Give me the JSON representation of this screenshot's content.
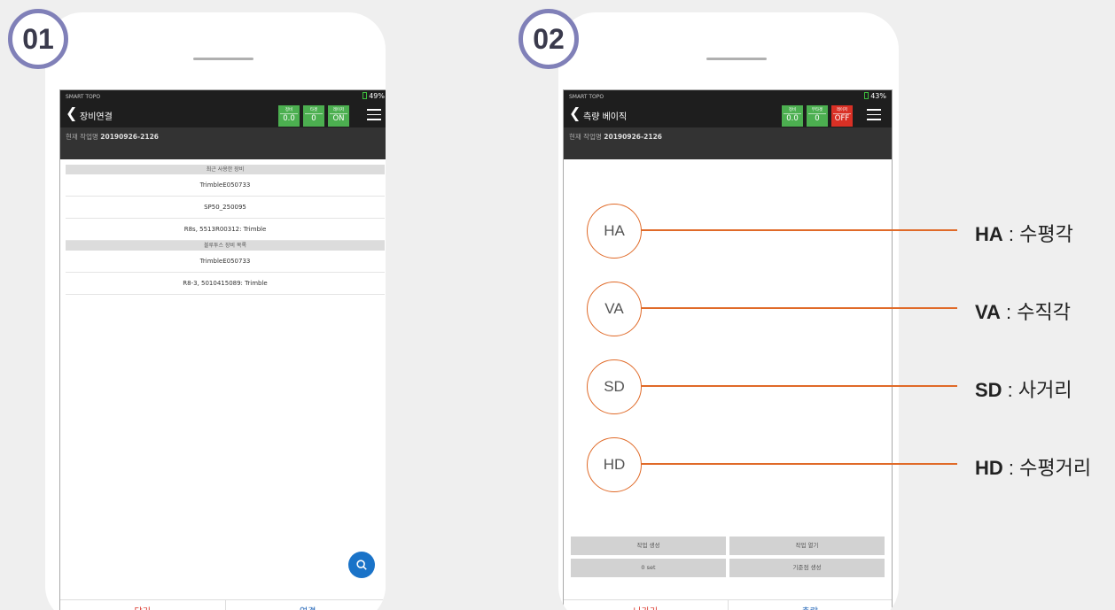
{
  "badges": {
    "first": "01",
    "second": "02"
  },
  "screen1": {
    "status_app": "SMART TOPO",
    "battery": "49%",
    "title": "장비연결",
    "indicators": [
      {
        "label": "정비",
        "value": "0.0",
        "color": "#4caf50"
      },
      {
        "label": "타겟",
        "value": "0",
        "color": "#4caf50"
      },
      {
        "label": "레이저",
        "value": "ON",
        "color": "#4caf50"
      }
    ],
    "job_prefix": "현재 작업명",
    "job_name": "20190926-2126",
    "recent_header": "최근 사용한 장비",
    "recent_devices": [
      "TrimbleE050733",
      "SP50_250095",
      "R8s, 5513R00312: Trimble"
    ],
    "bluetooth_header": "블루투스 장비 목록",
    "bluetooth_devices": [
      "TrimbleE050733",
      "R8-3, 5010415089: Trimble"
    ],
    "close_label": "닫기",
    "connect_label": "연결",
    "search_icon": "search-icon"
  },
  "screen2": {
    "status_app": "SMART TOPO",
    "battery": "43%",
    "title": "측량 베이직",
    "indicators": [
      {
        "label": "정비",
        "value": "0.0",
        "color": "#4caf50"
      },
      {
        "label": "무타겟",
        "value": "0",
        "color": "#4caf50"
      },
      {
        "label": "레이저",
        "value": "OFF",
        "color": "#d93025"
      }
    ],
    "job_prefix": "현재 작업명",
    "job_name": "20190926-2126",
    "measures": [
      "HA",
      "VA",
      "SD",
      "HD"
    ],
    "buttons": [
      "작업 생성",
      "작업 열기",
      "0 set",
      "기준점 생성"
    ],
    "exit_label": "나가기",
    "measure_label": "측량"
  },
  "callouts": [
    {
      "key": "HA",
      "sep": " : ",
      "desc": "수평각"
    },
    {
      "key": "VA",
      "sep": " : ",
      "desc": "수직각"
    },
    {
      "key": "SD",
      "sep": " : ",
      "desc": "사거리"
    },
    {
      "key": "HD",
      "sep": " : ",
      "desc": "수평거리"
    }
  ],
  "accent_color": "#e06a28"
}
